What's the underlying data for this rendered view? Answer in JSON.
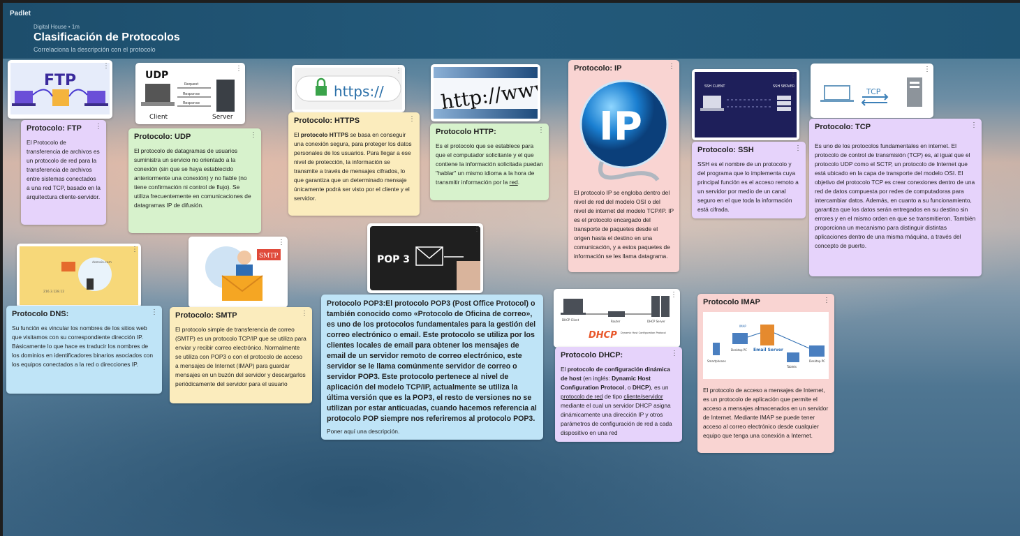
{
  "header": {
    "logo": "Padlet",
    "meta": "Digital House • 1m",
    "title": "Clasificación de Protocolos",
    "subtitle": "Correlaciona la descripción con el protocolo"
  },
  "cards": {
    "ftp": {
      "title": "Protocolo: FTP",
      "body": "El Protocolo de transferencia de archivos es un protocolo de red para la transferencia de archivos entre sistemas conectados a una red TCP, basado en la arquitectura cliente-servidor.",
      "img_label": "FTP"
    },
    "udp": {
      "title": "Protocolo: UDP",
      "body": "El protocolo de datagramas de usuarios suministra un servicio no orientado a la conexión (sin que se haya establecido anteriormente una conexión) y no fiable (no tiene confirmación ni control de flujo). Se utiliza frecuentemente en comunicaciones de datagramas IP de difusión.",
      "img_label": "UDP",
      "img_client": "Client",
      "img_server": "Server",
      "img_request": "Request",
      "img_response": "Response"
    },
    "https": {
      "title": "Protocolo: HTTPS",
      "body_1": "El ",
      "body_bold": "protocolo HTTPS",
      "body_2": " se basa en conseguir una conexión segura, para proteger los datos personales de los usuarios. Para llegar a ese nivel de protección, la información se transmite a través de mensajes cifrados, lo que garantiza que un determinado mensaje únicamente podrá ser visto por el cliente y el servidor.",
      "img_label": "https://"
    },
    "http": {
      "title": "Protocolo HTTP:",
      "body": "Es el protocolo que se establece para que el computador solicitante y el que contiene la información solicitada puedan \"hablar\" un mismo idioma a la hora de transmitir información por la ",
      "body_link": "red",
      "body_end": ".",
      "img_label": "http://www"
    },
    "ip": {
      "title": "Protocolo: IP",
      "body": "El protocolo IP se engloba dentro del nivel de red del modelo OSI o del nivel de internet del modelo TCP/IP. IP es el protocolo encargado del transporte de paquetes desde el origen hasta el destino en una comunicación, y a estos paquetes de información se les llama datagrama.",
      "img_label": "IP"
    },
    "ssh": {
      "title": "Protocolo: SSH",
      "body": "SSH es el nombre de un protocolo y del programa que lo implementa cuya principal función es el acceso remoto a un servidor por medio de un canal seguro en el que toda la información está cifrada.",
      "img_client": "SSH CLIENT",
      "img_server": "SSH SERVER"
    },
    "tcp": {
      "title": "Protocolo: TCP",
      "body": "Es uno de los protocolos fundamentales en internet. El protocolo de control de transmisión (TCP) es, al igual que el protocolo UDP como el SCTP, un protocolo de Internet que está ubicado en la capa de transporte del modelo OSI. El objetivo del protocolo TCP es crear conexiones dentro de una red de datos compuesta por redes de computadoras para intercambiar datos. Además, en cuanto a su funcionamiento, garantiza que los datos serán entregados en su destino sin errores y en el mismo orden en que se transmitieron. También proporciona un mecanismo para distinguir distintas aplicaciones dentro de una misma máquina, a través del concepto de puerto.",
      "img_label": "TCP"
    },
    "dns": {
      "title": "Protocolo DNS:",
      "body": "Su función es vincular los nombres de los sitios web que visitamos con su correspondiente dirección IP. Básicamente lo que hace es traducir los nombres de los dominios en identificadores binarios asociados con los equipos conectados a la red o direcciones IP.",
      "img_domain": "domain.com",
      "img_ip": "216.3.128.12"
    },
    "smtp": {
      "title": "Protocolo: SMTP",
      "body": "El protocolo simple de transferencia de correo (SMTP) es un protocolo TCP/IP que se utiliza para enviar y recibir correo electrónico. Normalmente se utiliza con POP3 o con el protocolo de acceso a mensajes de Internet (IMAP) para guardar mensajes en un buzón del servidor y descargarlos periódicamente del servidor para el usuario",
      "img_label": "SMTP"
    },
    "pop3": {
      "title": "Protocolo POP3:El protocolo POP3 (Post Office Protocol) o también conocido como «Protocolo de Oficina de correo», es uno de los protocolos fundamentales para la gestión del correo electrónico o email. Este protocolo se utiliza por los clientes locales de email para obtener los mensajes de email de un servidor remoto de correo electrónico, este servidor se le llama comúnmente servidor de correo o servidor POP3. Este protocolo pertenece al nivel de aplicación del modelo TCP/IP, actualmente se utiliza la última versión que es la POP3, el resto de versiones no se utilizan por estar anticuadas, cuando hacemos referencia al protocolo POP siempre nos referiremos al protocolo POP3.",
      "body": "Poner aquí una descripción.",
      "img_label": "POP 3"
    },
    "dhcp": {
      "title": "Protocolo DHCP:",
      "b1": " El ",
      "b2": "protocolo de configuración dinámica de host",
      "b3": " (en inglés: ",
      "b4": "Dynamic Host Configuration Protocol",
      "b5": ", o ",
      "b6": "DHCP",
      "b7": "), es un ",
      "b8": "protocolo de red",
      "b9": " de tipo ",
      "b10": "cliente/servidor",
      "b11": " mediante el cual un servidor DHCP asigna dinámicamente una dirección IP y otros parámetros de configuración de red a cada dispositivo en una red",
      "img_label": "DHCP",
      "img_client": "DHCP Client",
      "img_router": "Router",
      "img_server": "DHCP Server",
      "img_sub": "Dynamic Host Configuration Protocol"
    },
    "imap": {
      "title": "Protocolo IMAP",
      "body": "El protocolo de acceso a mensajes de Internet, es un protocolo de aplicación que permite el acceso a mensajes almacenados en un servidor de Internet. Mediante IMAP se puede tener acceso al correo electrónico desde cualquier equipo que tenga una conexión a Internet.",
      "img_server": "Email Server",
      "img_imap": "IMAP",
      "img_smartphones": "Smartphones",
      "img_desktop": "Desktop PC",
      "img_tablets": "Tablets"
    }
  },
  "menu_glyph": "⋮"
}
